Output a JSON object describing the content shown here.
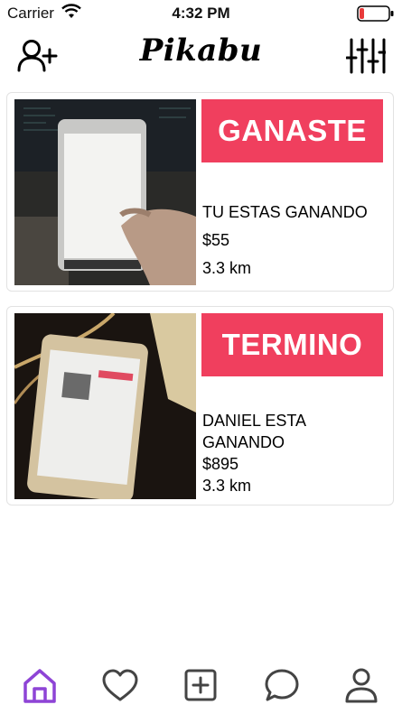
{
  "status_bar": {
    "carrier": "Carrier",
    "time": "4:32 PM",
    "battery_color": "#e83a3a"
  },
  "nav": {
    "title": "Pikabu",
    "left_icon": "add-user-icon",
    "right_icon": "sliders-icon"
  },
  "items": [
    {
      "status": "GANASTE",
      "text": "TU ESTAS GANANDO",
      "price": "$55",
      "distance": "3.3 km"
    },
    {
      "status": "TERMINO",
      "text": "DANIEL ESTA GANANDO",
      "price": "$895",
      "distance": "3.3 km"
    }
  ],
  "tabs": [
    {
      "icon": "home-icon",
      "active": true
    },
    {
      "icon": "heart-icon",
      "active": false
    },
    {
      "icon": "add-post-icon",
      "active": false
    },
    {
      "icon": "chat-icon",
      "active": false
    },
    {
      "icon": "profile-icon",
      "active": false
    }
  ],
  "colors": {
    "accent": "#f03f5e",
    "tab_active": "#8e44d6",
    "tab_inactive": "#444444"
  }
}
